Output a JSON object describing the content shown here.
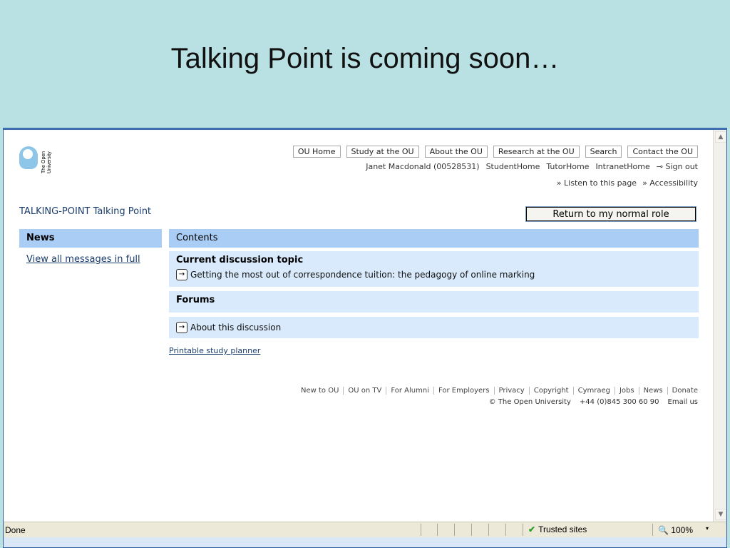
{
  "slide": {
    "title": "Talking Point is coming soon…"
  },
  "logo": {
    "text": "The Open University"
  },
  "topnav": [
    "OU Home",
    "Study at the OU",
    "About the OU",
    "Research at the OU",
    "Search",
    "Contact the OU"
  ],
  "userline": {
    "name": "Janet Macdonald (00528531)",
    "links": [
      "StudentHome",
      "TutorHome",
      "IntranetHome"
    ],
    "signout": "⊸ Sign out"
  },
  "listen": {
    "listen": "» Listen to this page",
    "accessibility": "» Accessibility"
  },
  "page": {
    "title": "TALKING-POINT Talking Point",
    "return_button": "Return to my normal role"
  },
  "sidebar": {
    "heading": "News",
    "link": "View all messages in full"
  },
  "main": {
    "contents_heading": "Contents",
    "current_heading": "Current discussion topic",
    "current_topic": "Getting the most out of correspondence tuition: the pedagogy of online marking",
    "forums_heading": "Forums",
    "about": "About this discussion",
    "planner": "Printable study planner"
  },
  "footer": {
    "links": [
      "New to OU",
      "OU on TV",
      "For Alumni",
      "For Employers",
      "Privacy",
      "Copyright",
      "Cymraeg",
      "Jobs",
      "News",
      "Donate"
    ],
    "copyright": "© The Open University",
    "phone": "+44 (0)845 300 60 90",
    "email": "Email us"
  },
  "statusbar": {
    "status": "Done",
    "zone": "Trusted sites",
    "zoom": "100%"
  },
  "colors": {
    "slide_bg": "#b9e0e3",
    "header_blue": "#a9cdf4",
    "box_blue": "#d8eafb",
    "link": "#1a3d6b"
  }
}
